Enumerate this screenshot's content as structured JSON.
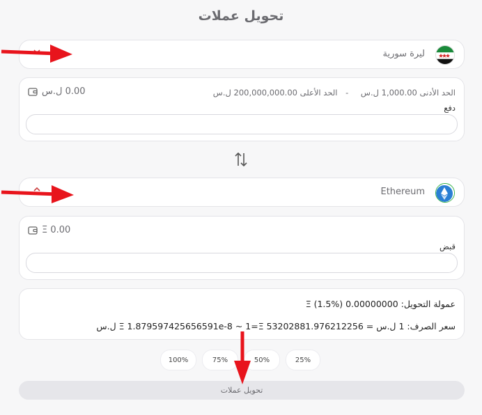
{
  "title": "تحويل عملات",
  "from_currency": {
    "name": "ليرة سورية",
    "flag_icon": "syria-flag-icon"
  },
  "from_amount": {
    "min_label": "الحد الأدنى 1,000.00 ل.س",
    "separator": "-",
    "max_label": "الحد الأعلى 200,000,000.00 ل.س",
    "balance": "0.00 ل.س",
    "field_label": "دفع",
    "value": ""
  },
  "to_currency": {
    "name": "Ethereum",
    "icon": "ethereum-icon"
  },
  "to_amount": {
    "balance": "Ξ 0.00",
    "field_label": "قبض",
    "value": ""
  },
  "fee": {
    "label": "عمولة التحويل: 0.00000000 Ξ (1.5%)",
    "rate": "سعر الصرف: 1 ل.س = Ξ 1.879597425656591e-8 ~ 1=Ξ 53202881.976212256 ل.س"
  },
  "percent_buttons": [
    "100%",
    "75%",
    "50%",
    "25%"
  ],
  "convert_button": "تحويل عملات",
  "colors": {
    "accent_red": "#e8141c",
    "ethereum_blue": "#2a7fd4"
  }
}
